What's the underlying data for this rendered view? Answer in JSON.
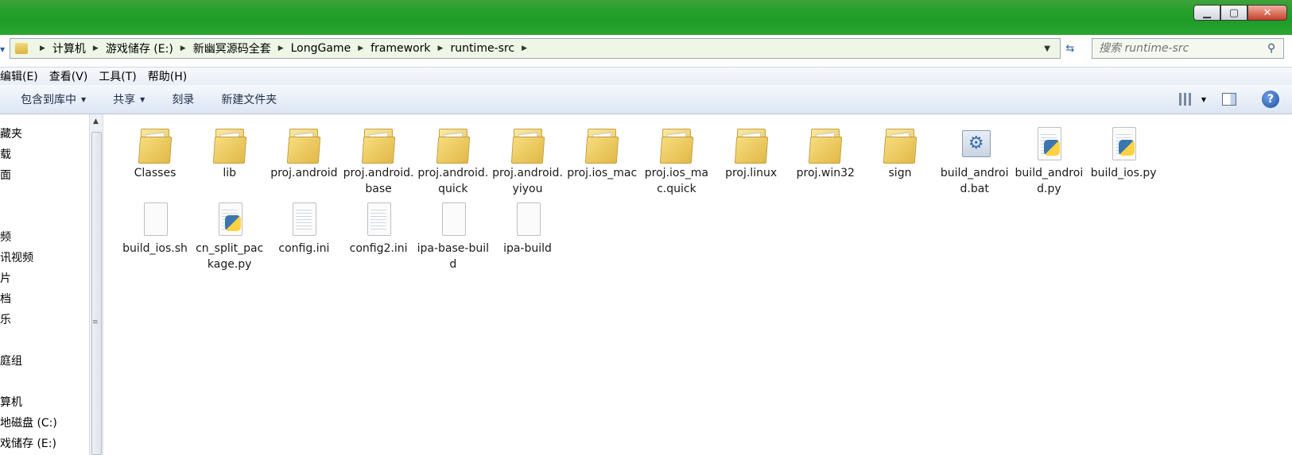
{
  "window": {
    "controls": {
      "minimize": "▁",
      "maximize": "▢",
      "close": "✕"
    }
  },
  "address": {
    "breadcrumbs": [
      "计算机",
      "游戏储存 (E:)",
      "新幽冥源码全套",
      "LongGame",
      "framework",
      "runtime-src"
    ],
    "search_placeholder": "搜索 runtime-src"
  },
  "menu": [
    "编辑(E)",
    "查看(V)",
    "工具(T)",
    "帮助(H)"
  ],
  "toolbar": {
    "include_library": "包含到库中",
    "share": "共享",
    "burn": "刻录",
    "new_folder": "新建文件夹",
    "help_label": "?"
  },
  "nav": {
    "items": [
      "藏夹",
      "载",
      "面",
      "频",
      "讯视频",
      "片",
      "档",
      "乐",
      "庭组",
      "算机",
      "地磁盘 (C:)",
      "戏储存 (E:)"
    ]
  },
  "files": [
    {
      "name": "Classes",
      "type": "folder"
    },
    {
      "name": "lib",
      "type": "folder"
    },
    {
      "name": "proj.android",
      "type": "folder"
    },
    {
      "name": "proj.android.base",
      "type": "folder"
    },
    {
      "name": "proj.android.quick",
      "type": "folder"
    },
    {
      "name": "proj.android.yiyou",
      "type": "folder"
    },
    {
      "name": "proj.ios_mac",
      "type": "folder"
    },
    {
      "name": "proj.ios_mac.quick",
      "type": "folder"
    },
    {
      "name": "proj.linux",
      "type": "folder"
    },
    {
      "name": "proj.win32",
      "type": "folder"
    },
    {
      "name": "sign",
      "type": "folder"
    },
    {
      "name": "build_android.bat",
      "type": "bat"
    },
    {
      "name": "build_android.py",
      "type": "py"
    },
    {
      "name": "build_ios.py",
      "type": "py"
    },
    {
      "name": "build_ios.sh",
      "type": "file"
    },
    {
      "name": "cn_split_package.py",
      "type": "py"
    },
    {
      "name": "config.ini",
      "type": "ini"
    },
    {
      "name": "config2.ini",
      "type": "ini"
    },
    {
      "name": "ipa-base-build",
      "type": "file"
    },
    {
      "name": "ipa-build",
      "type": "file"
    }
  ]
}
